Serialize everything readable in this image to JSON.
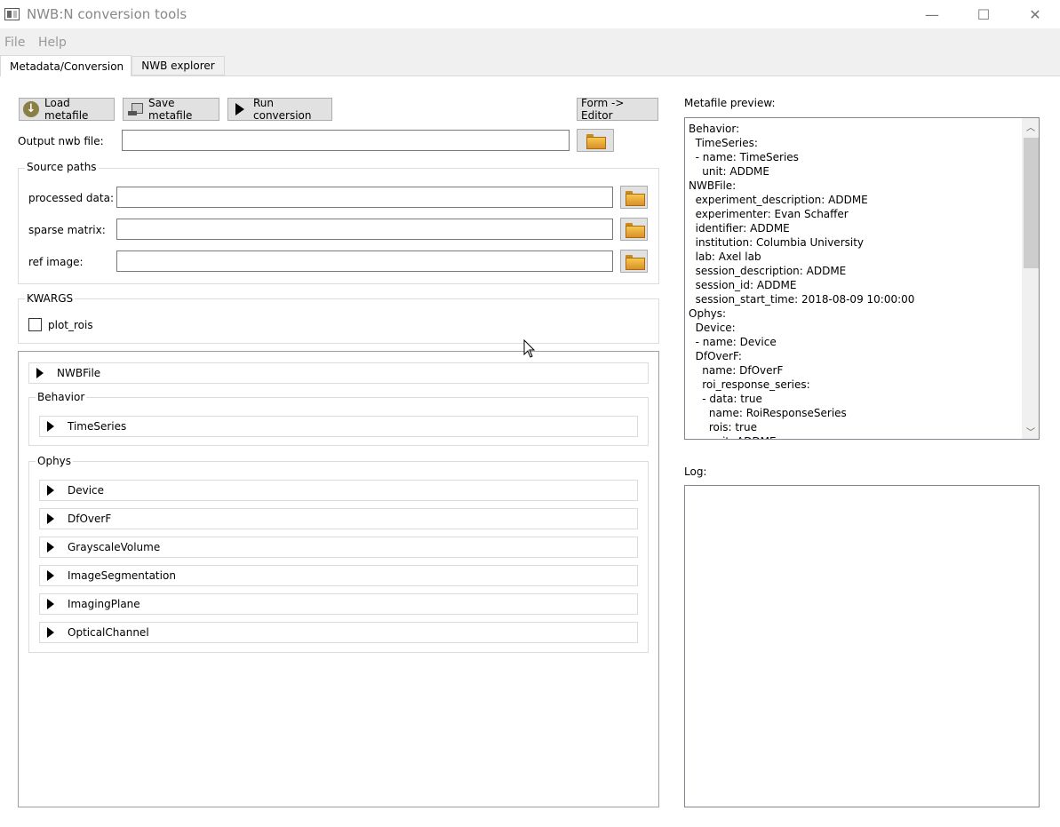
{
  "window": {
    "title": "NWB:N conversion tools",
    "minimize_glyph": "—",
    "maximize_glyph": "☐",
    "close_glyph": "✕"
  },
  "menu": [
    "File",
    "Help"
  ],
  "tabs": [
    "Metadata/Conversion",
    "NWB explorer"
  ],
  "toolbar": {
    "load": "Load metafile",
    "save": "Save metafile",
    "run": "Run conversion",
    "form_editor": "Form -> Editor"
  },
  "output": {
    "label": "Output nwb file:",
    "value": ""
  },
  "source_paths": {
    "title": "Source paths",
    "fields": [
      {
        "label": "processed data:",
        "value": ""
      },
      {
        "label": "sparse matrix:",
        "value": ""
      },
      {
        "label": "ref image:",
        "value": ""
      }
    ]
  },
  "kwargs": {
    "title": "KWARGS",
    "checkbox_label": "plot_rois",
    "checked": false
  },
  "form": {
    "nwbfile": "NWBFile",
    "behavior": {
      "title": "Behavior",
      "items": [
        "TimeSeries"
      ]
    },
    "ophys": {
      "title": "Ophys",
      "items": [
        "Device",
        "DfOverF",
        "GrayscaleVolume",
        "ImageSegmentation",
        "ImagingPlane",
        "OpticalChannel"
      ]
    }
  },
  "preview": {
    "label": "Metafile preview:",
    "lines": [
      "Behavior:",
      "  TimeSeries:",
      "  - name: TimeSeries",
      "    unit: ADDME",
      "NWBFile:",
      "  experiment_description: ADDME",
      "  experimenter: Evan Schaffer",
      "  identifier: ADDME",
      "  institution: Columbia University",
      "  lab: Axel lab",
      "  session_description: ADDME",
      "  session_id: ADDME",
      "  session_start_time: 2018-08-09 10:00:00",
      "Ophys:",
      "  Device:",
      "  - name: Device",
      "  DfOverF:",
      "    name: DfOverF",
      "    roi_response_series:",
      "    - data: true",
      "      name: RoiResponseSeries",
      "      rois: true",
      "      unit: ADDME"
    ]
  },
  "log": {
    "label": "Log:",
    "value": ""
  }
}
